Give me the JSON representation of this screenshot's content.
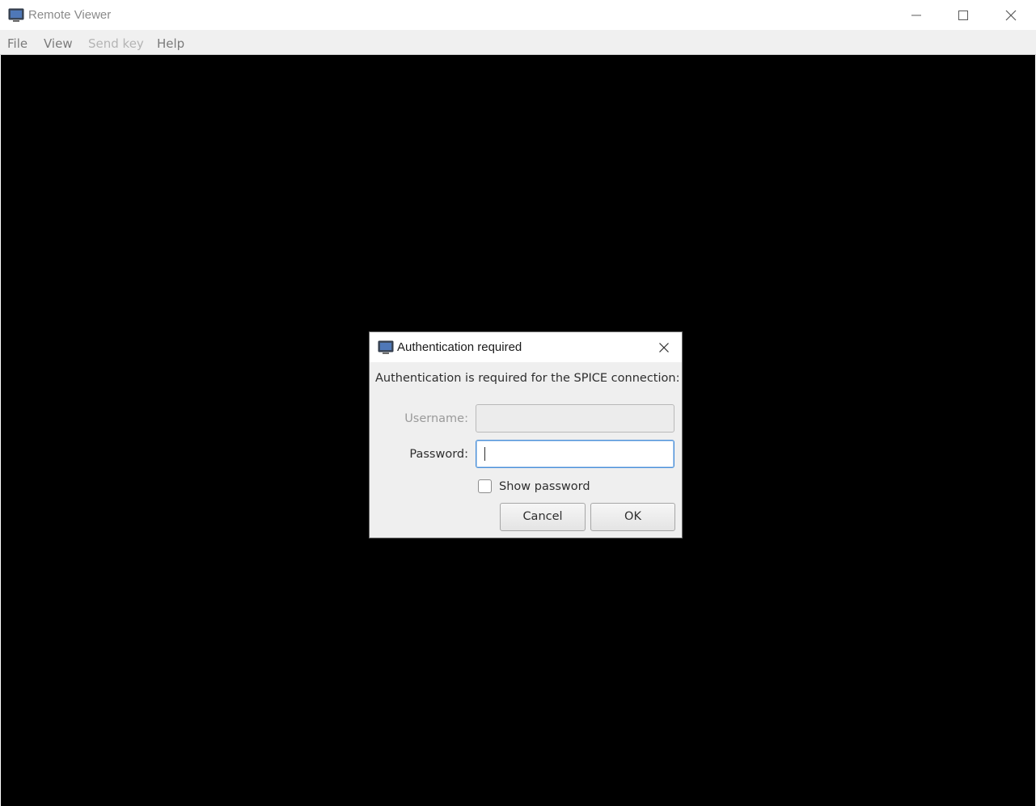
{
  "window": {
    "title": "Remote Viewer",
    "controls": {
      "minimize_icon": "minimize-icon",
      "maximize_icon": "maximize-icon",
      "close_icon": "close-icon"
    }
  },
  "menubar": {
    "items": [
      {
        "label": "File",
        "enabled": true
      },
      {
        "label": "View",
        "enabled": true
      },
      {
        "label": "Send key",
        "enabled": false
      },
      {
        "label": "Help",
        "enabled": true
      }
    ]
  },
  "display": {
    "background": "#000000"
  },
  "dialog": {
    "title": "Authentication required",
    "message": "Authentication is required for the SPICE connection:",
    "username": {
      "label": "Username:",
      "value": "",
      "enabled": false
    },
    "password": {
      "label": "Password:",
      "value": "",
      "focused": true
    },
    "show_password": {
      "label": "Show password",
      "checked": false
    },
    "buttons": {
      "cancel": "Cancel",
      "ok": "OK"
    }
  },
  "colors": {
    "focus_border": "#4a90d9",
    "dialog_bg": "#efefef",
    "menubar_bg": "#f0f0f0"
  }
}
